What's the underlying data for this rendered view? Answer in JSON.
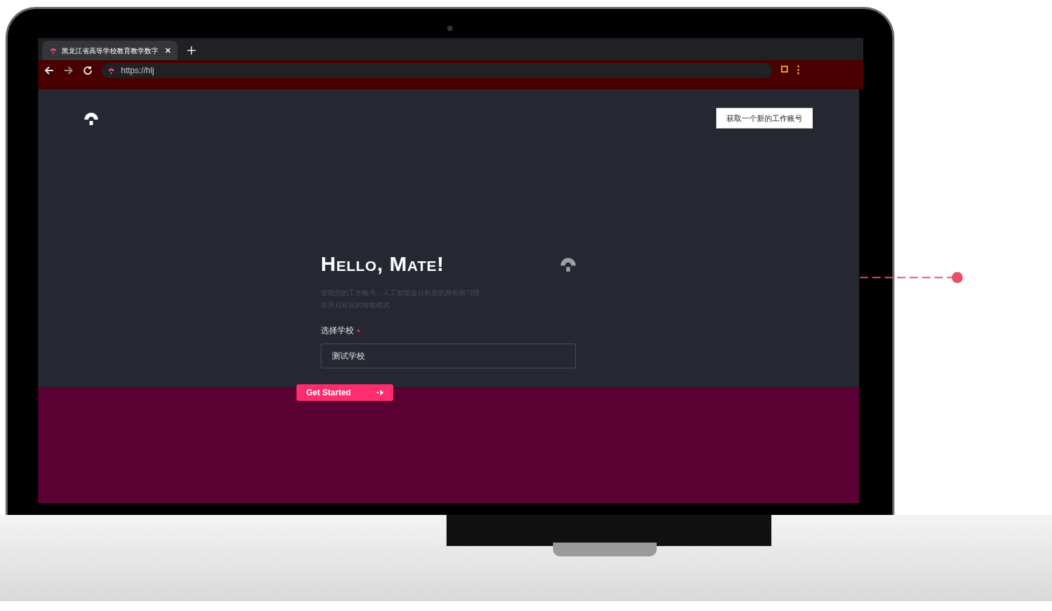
{
  "browser": {
    "tabs": [
      {
        "title": "黑龙江省高等学校教育教学数字",
        "selected": true
      }
    ],
    "address": "https://hlj"
  },
  "header": {
    "button": "获取一个新的工作账号"
  },
  "login": {
    "title": "Hello, Mate!",
    "subtitle_lines": [
      "登陆您的工作账号，人工智能会分析您的身份和习惯",
      "并开启对应的智能模式"
    ],
    "field": {
      "label": "选择学校",
      "required": true,
      "value": "测试学校"
    },
    "submit": "Get Started"
  }
}
